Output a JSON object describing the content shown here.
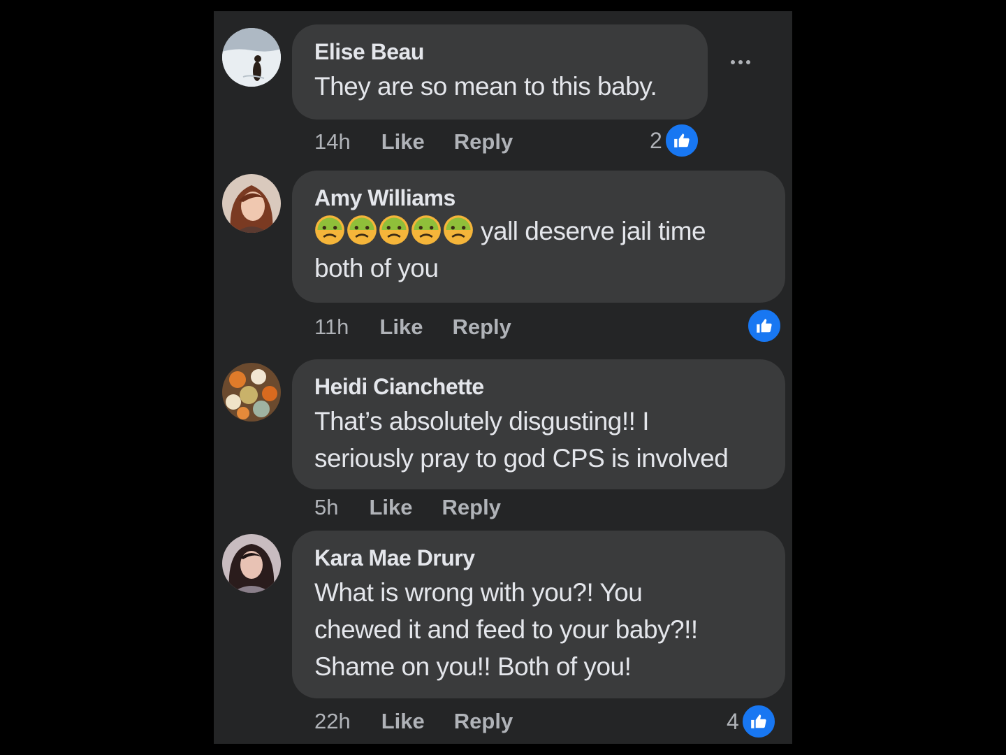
{
  "comments": [
    {
      "author": "Elise Beau",
      "lines": [
        "They are so mean to this baby."
      ],
      "time": "14h",
      "like_label": "Like",
      "reply_label": "Reply",
      "reaction_count": "2",
      "avatar": "snow-landscape-dog-avatar"
    },
    {
      "author": "Amy Williams",
      "emoji": "nauseated-face-emoji",
      "emoji_count": 5,
      "lines": [
        "yall deserve jail time",
        "both of you"
      ],
      "time": "11h",
      "like_label": "Like",
      "reply_label": "Reply",
      "reaction_count": "",
      "avatar": "woman-red-hair-avatar"
    },
    {
      "author": "Heidi Cianchette",
      "lines": [
        "That’s absolutely disgusting!! I",
        "seriously pray to god CPS is involved"
      ],
      "time": "5h",
      "like_label": "Like",
      "reply_label": "Reply",
      "avatar": "pumpkins-avatar"
    },
    {
      "author": "Kara Mae Drury",
      "lines": [
        "What is wrong with you?! You",
        "chewed it and feed to your baby?!!",
        "Shame on you!! Both of you!"
      ],
      "time": "22h",
      "like_label": "Like",
      "reply_label": "Reply",
      "reaction_count": "4",
      "avatar": "woman-dark-hair-avatar"
    }
  ],
  "colors": {
    "background": "#000000",
    "panel": "#242526",
    "bubble": "#3a3b3c",
    "text_primary": "#e4e6eb",
    "text_secondary": "#b0b3b8",
    "like_blue": "#1877f2"
  }
}
